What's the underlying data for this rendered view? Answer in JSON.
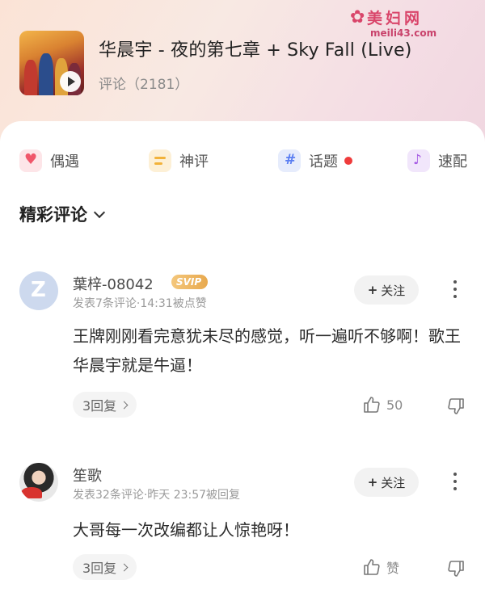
{
  "header": {
    "song_title": "华晨宇 - 夜的第七章 + Sky Fall (Live)",
    "comment_count": "评论（2181）"
  },
  "watermark": {
    "name": "美妇网",
    "url": "meili43.com"
  },
  "categories": [
    {
      "label": "偶遇",
      "icon": "heart-icon",
      "color": "#f0566a"
    },
    {
      "label": "神评",
      "icon": "list-icon",
      "color": "#f2b23a"
    },
    {
      "label": "话题",
      "icon": "hashtag-icon",
      "color": "#5a7ef2",
      "has_dot": true
    },
    {
      "label": "速配",
      "icon": "music-note-icon",
      "color": "#a65be4"
    }
  ],
  "section_title": "精彩评论",
  "comments": [
    {
      "username": "葉梓-08042",
      "badge": "SVIP",
      "meta": "发表7条评论·14:31被点赞",
      "follow_label": "关注",
      "text": "王牌刚刚看完意犹未尽的感觉，听一遍听不够啊！歌王华晨宇就是牛逼！",
      "replies_label": "3回复",
      "likes": "50"
    },
    {
      "username": "笙歌",
      "meta": "发表32条评论·昨天 23:57被回复",
      "follow_label": "关注",
      "text": "大哥每一次改编都让人惊艳呀！",
      "replies_label": "3回复",
      "likes": "赞"
    }
  ],
  "colors": {
    "accent_red": "#ef3b3b",
    "svip_gold": "#e8a94e",
    "header_bg": "#fbe3d6"
  }
}
